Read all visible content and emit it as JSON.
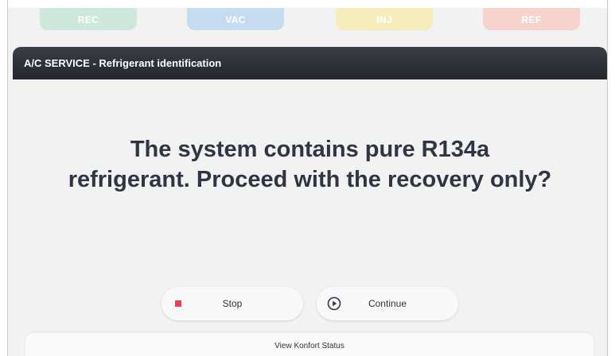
{
  "phase_tabs": [
    {
      "label": "REC",
      "color": "#cfe8dc"
    },
    {
      "label": "VAC",
      "color": "#c6dcf1"
    },
    {
      "label": "INJ",
      "color": "#f6edbd"
    },
    {
      "label": "REF",
      "color": "#f6d3cf"
    }
  ],
  "card": {
    "title": "A/C SERVICE - Refrigerant identification",
    "message_line1": "The system contains pure R134a",
    "message_line2": "refrigerant. Proceed with the recovery only?"
  },
  "buttons": {
    "stop": {
      "label": "Stop",
      "icon": "stop-square-icon",
      "icon_color": "#e94452"
    },
    "continue": {
      "label": "Continue",
      "icon": "play-circle-icon"
    }
  },
  "status_bar": {
    "label": "View Konfort Status"
  },
  "colors": {
    "header_bg": "#2b2e34",
    "message_text": "#2f3542",
    "panel_bg": "#f2f2f2"
  }
}
